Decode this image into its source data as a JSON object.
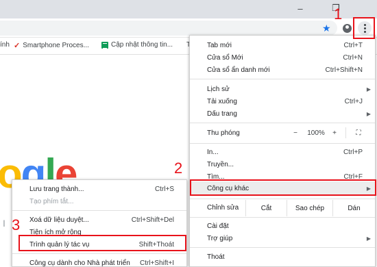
{
  "window": {
    "minimize_glyph": "–",
    "restore_glyph": "❐"
  },
  "bookmarks": [
    {
      "label": "ính"
    },
    {
      "label": "Smartphone Proces..."
    },
    {
      "label": "Cập nhật thông tin..."
    },
    {
      "label": "T"
    }
  ],
  "page": {
    "logo_letters": [
      "o",
      "g",
      "l",
      "e"
    ]
  },
  "main_menu": {
    "new_tab": {
      "label": "Tab mới",
      "shortcut": "Ctrl+T"
    },
    "new_window": {
      "label": "Cửa sổ Mới",
      "shortcut": "Ctrl+N"
    },
    "incognito": {
      "label": "Cửa sổ ẩn danh mới",
      "shortcut": "Ctrl+Shift+N"
    },
    "history": {
      "label": "Lịch sử"
    },
    "downloads": {
      "label": "Tải xuống",
      "shortcut": "Ctrl+J"
    },
    "bookmarks": {
      "label": "Dấu trang"
    },
    "zoom": {
      "label": "Thu phóng",
      "minus": "−",
      "value": "100%",
      "plus": "+",
      "fullscreen": "⛶"
    },
    "print": {
      "label": "In...",
      "shortcut": "Ctrl+P"
    },
    "cast": {
      "label": "Truyền..."
    },
    "find": {
      "label": "Tìm...",
      "shortcut": "Ctrl+F"
    },
    "more_tools": {
      "label": "Công cụ khác"
    },
    "edit": {
      "label": "Chỉnh sửa",
      "cut": "Cắt",
      "copy": "Sao chép",
      "paste": "Dán"
    },
    "settings": {
      "label": "Cài đặt"
    },
    "help": {
      "label": "Trợ giúp"
    },
    "exit": {
      "label": "Thoát"
    }
  },
  "sub_menu": {
    "save_page": {
      "label": "Lưu trang thành...",
      "shortcut": "Ctrl+S"
    },
    "create_shortcut": {
      "label": "Tạo phím tắt..."
    },
    "clear_data": {
      "label": "Xoá dữ liệu duyệt...",
      "shortcut": "Ctrl+Shift+Del"
    },
    "extensions": {
      "label": "Tiện ích mở rộng"
    },
    "task_manager": {
      "label": "Trình quản lý tác vụ",
      "shortcut": "Shift+Thoát"
    },
    "dev_tools": {
      "label": "Công cụ dành cho Nhà phát triển",
      "shortcut": "Ctrl+Shift+I"
    }
  },
  "annotations": [
    "1",
    "2",
    "3",
    "I"
  ],
  "colors": {
    "annotation": "#e8121a",
    "star": "#1a73e8"
  }
}
